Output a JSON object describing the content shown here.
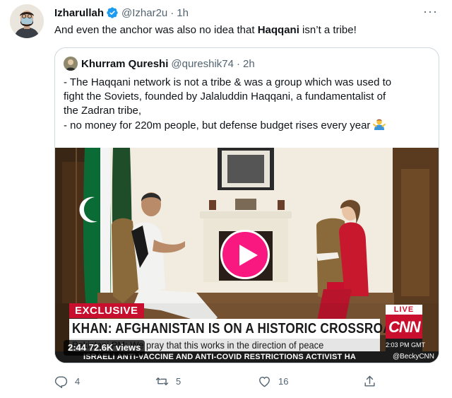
{
  "tweet": {
    "author_name": "Izharullah",
    "author_handle": "@Izhar2u",
    "separator": "·",
    "time": "1h",
    "text_before": "And even the anchor was also no idea that ",
    "text_bold": "Haqqani",
    "text_after": " isn’t a tribe!",
    "more_label": "···"
  },
  "quote": {
    "author_name": "Khurram Qureshi",
    "author_handle": "@qureshik74",
    "separator": "·",
    "time": "2h",
    "line1": "- The Haqqani network is not a tribe & was a group which was used to",
    "line2": "fight the Soviets, founded by Jalaluddin Haqqani, a fundamentalist of",
    "line3": "the Zadran tribe,",
    "line4": "- no money for 220m people, but defense budget rises every year",
    "emoji": "man-shrugging-emoji"
  },
  "video": {
    "exclusive_label": "EXCLUSIVE",
    "headline": "KHAN: AFGHANISTAN IS ON A HISTORIC CROSSROADS",
    "subline": "Pakistani PM: We pray that this works in the direction of peace",
    "ticker": "ISRAELI ANTI-VACCINE AND ANTI-COVID RESTRICTIONS ACTIVIST HA",
    "ticker_handle": "@BeckyCNN",
    "live_label": "LIVE",
    "network_logo": "CNN",
    "clock": "2:03 PM GMT",
    "duration_views": "2:44  72.6K views"
  },
  "actions": {
    "reply_count": "4",
    "retweet_count": "5",
    "like_count": "16"
  },
  "colors": {
    "accent": "#1d9bf0",
    "play": "#f91880",
    "cnn_red": "#c8102e",
    "muted": "#536471",
    "border": "#cfd9de"
  }
}
